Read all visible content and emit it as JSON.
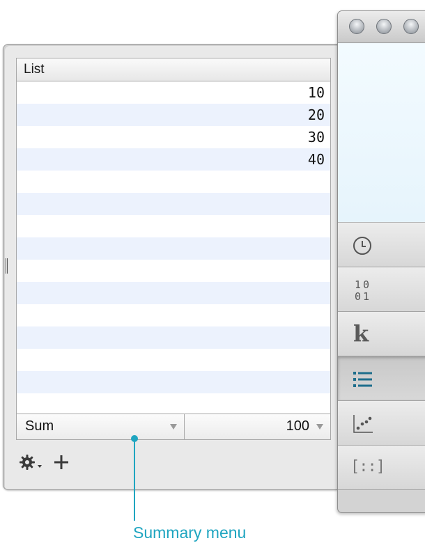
{
  "list": {
    "header": "List",
    "rows": [
      "10",
      "20",
      "30",
      "40",
      "",
      "",
      "",
      "",
      "",
      "",
      "",
      "",
      "",
      "",
      ""
    ]
  },
  "summary": {
    "menu_label": "Sum",
    "value": "100"
  },
  "tools": {
    "settings_icon": "gear-icon",
    "add_icon": "plus-icon"
  },
  "sidebar_tabs": [
    {
      "name": "history",
      "icon": "clock-icon"
    },
    {
      "name": "programmer",
      "icon": "binary-icon",
      "text": "10\n01"
    },
    {
      "name": "constants",
      "icon": "k-icon",
      "text": "k"
    },
    {
      "name": "list",
      "icon": "list-icon",
      "active": true
    },
    {
      "name": "statistics",
      "icon": "scatter-icon"
    },
    {
      "name": "matrix",
      "icon": "matrix-icon",
      "text": "[::]"
    }
  ],
  "annotation": {
    "label": "Summary menu"
  },
  "colors": {
    "accent": "#1fa5c0",
    "active_tab_icon": "#1e6e8c",
    "row_stripe": "#ecf2fd"
  }
}
